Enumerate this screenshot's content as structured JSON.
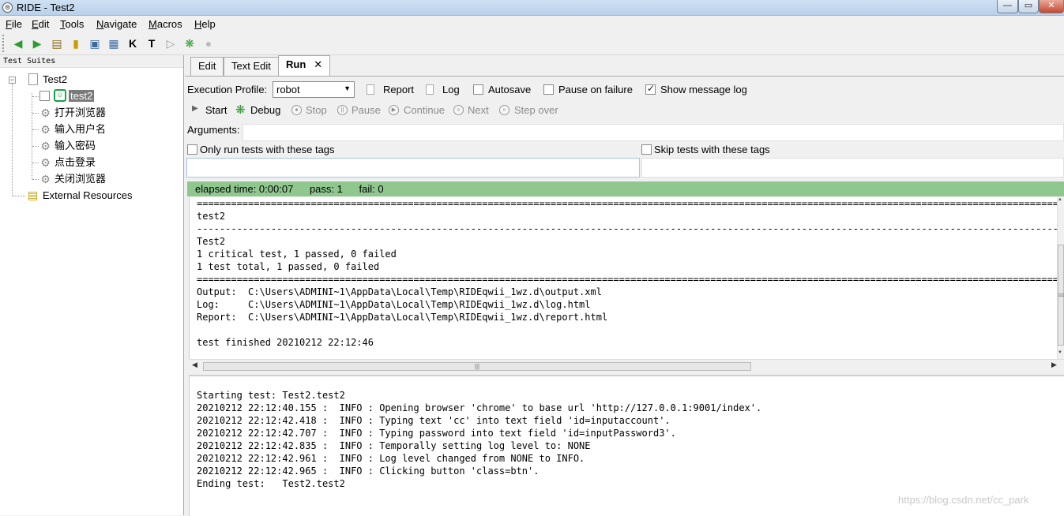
{
  "window": {
    "title": "RIDE - Test2",
    "app_icon": "⊜",
    "minimize": "—",
    "maximize": "▭",
    "close": "✕"
  },
  "menu": {
    "file": "File",
    "edit": "Edit",
    "tools": "Tools",
    "navigate": "Navigate",
    "macros": "Macros",
    "help": "Help"
  },
  "toolbar": {
    "icons": [
      "arrow-back-icon",
      "arrow-forward-icon",
      "open-folder-icon",
      "open-directory-icon",
      "save-icon",
      "save-all-icon",
      "search-keywords-icon",
      "search-tests-icon",
      "run-icon",
      "debug-icon",
      "stop-icon"
    ]
  },
  "tree": {
    "header": "Test Suites",
    "root": "Test2",
    "test_case": "test2",
    "keywords": [
      "打开浏览器",
      "输入用户名",
      "输入密码",
      "点击登录",
      "关闭浏览器"
    ],
    "external": "External Resources",
    "expander": "−"
  },
  "tabs": {
    "edit": "Edit",
    "text_edit": "Text Edit",
    "run": "Run",
    "close": "✕"
  },
  "run": {
    "profile_label": "Execution Profile:",
    "profile_value": "robot",
    "report": "Report",
    "log": "Log",
    "autosave": "Autosave",
    "pause_on_failure": "Pause on failure",
    "show_message_log": "Show message log",
    "start": "Start",
    "debug": "Debug",
    "stop": "Stop",
    "pause": "Pause",
    "continue": "Continue",
    "next": "Next",
    "step_over": "Step over",
    "arguments_label": "Arguments:",
    "arguments_value": "",
    "only_run_tags": "Only run tests with these tags",
    "skip_tags": "Skip tests with these tags",
    "only_run_value": "",
    "skip_value": ""
  },
  "status": {
    "elapsed": "elapsed time: 0:00:07",
    "pass": "pass: 1",
    "fail": "fail: 0",
    "color": "#8fc78f"
  },
  "console_top": [
    "==============================================================================================================================================================================",
    "test2",
    "------------------------------------------------------------------------------------------------------------------------------------------------------------------------------",
    "Test2",
    "1 critical test, 1 passed, 0 failed",
    "1 test total, 1 passed, 0 failed",
    "==============================================================================================================================================================================",
    "Output:  C:\\Users\\ADMINI~1\\AppData\\Local\\Temp\\RIDEqwii_1wz.d\\output.xml",
    "Log:     C:\\Users\\ADMINI~1\\AppData\\Local\\Temp\\RIDEqwii_1wz.d\\log.html",
    "Report:  C:\\Users\\ADMINI~1\\AppData\\Local\\Temp\\RIDEqwii_1wz.d\\report.html",
    "",
    "test finished 20210212 22:12:46"
  ],
  "console_bottom": [
    "Starting test: Test2.test2",
    "20210212 22:12:40.155 :  INFO : Opening browser 'chrome' to base url 'http://127.0.0.1:9001/index'.",
    "20210212 22:12:42.418 :  INFO : Typing text 'cc' into text field 'id=inputaccount'.",
    "20210212 22:12:42.707 :  INFO : Typing password into text field 'id=inputPassword3'.",
    "20210212 22:12:42.835 :  INFO : Temporally setting log level to: NONE",
    "20210212 22:12:42.961 :  INFO : Log level changed from NONE to INFO.",
    "20210212 22:12:42.965 :  INFO : Clicking button 'class=btn'.",
    "Ending test:   Test2.test2"
  ],
  "scrollbar": {
    "grip": "|||",
    "up": "▲",
    "down": "▼",
    "left": "◀",
    "right": "▶"
  },
  "watermark": "https://blog.csdn.net/cc_park"
}
